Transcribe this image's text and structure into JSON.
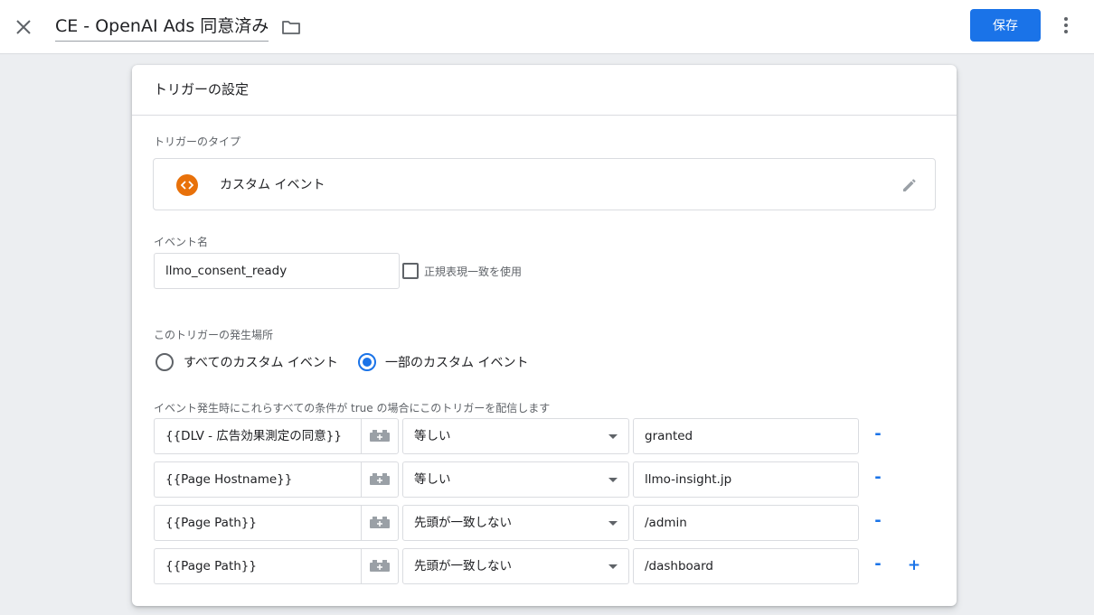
{
  "header": {
    "title": "CE - OpenAI Ads 同意済み",
    "save_label": "保存",
    "close_icon": "close-icon",
    "folder_icon": "folder-icon",
    "more_icon": "more-vert-icon"
  },
  "card": {
    "title": "トリガーの設定",
    "trigger_type_label": "トリガーのタイプ",
    "trigger_type_name": "カスタム イベント",
    "event_name_label": "イベント名",
    "event_name_value": "llmo_consent_ready",
    "regex_label": "正規表現一致を使用",
    "regex_checked": false,
    "fires_on_label": "このトリガーの発生場所",
    "fires_on_options": [
      {
        "label": "すべてのカスタム イベント",
        "checked": false
      },
      {
        "label": "一部のカスタム イベント",
        "checked": true
      }
    ],
    "conditions_label": "イベント発生時にこれらすべての条件が true の場合にこのトリガーを配信します",
    "conditions": [
      {
        "variable": "{{DLV - 広告効果測定の同意}}",
        "operator": "等しい",
        "value": "granted"
      },
      {
        "variable": "{{Page Hostname}}",
        "operator": "等しい",
        "value": "llmo-insight.jp"
      },
      {
        "variable": "{{Page Path}}",
        "operator": "先頭が一致しない",
        "value": "/admin"
      },
      {
        "variable": "{{Page Path}}",
        "operator": "先頭が一致しない",
        "value": "/dashboard"
      }
    ],
    "minus_label": "-",
    "plus_label": "+"
  },
  "colors": {
    "accent": "#1a73e8",
    "trigger_icon": "#e8710a"
  }
}
